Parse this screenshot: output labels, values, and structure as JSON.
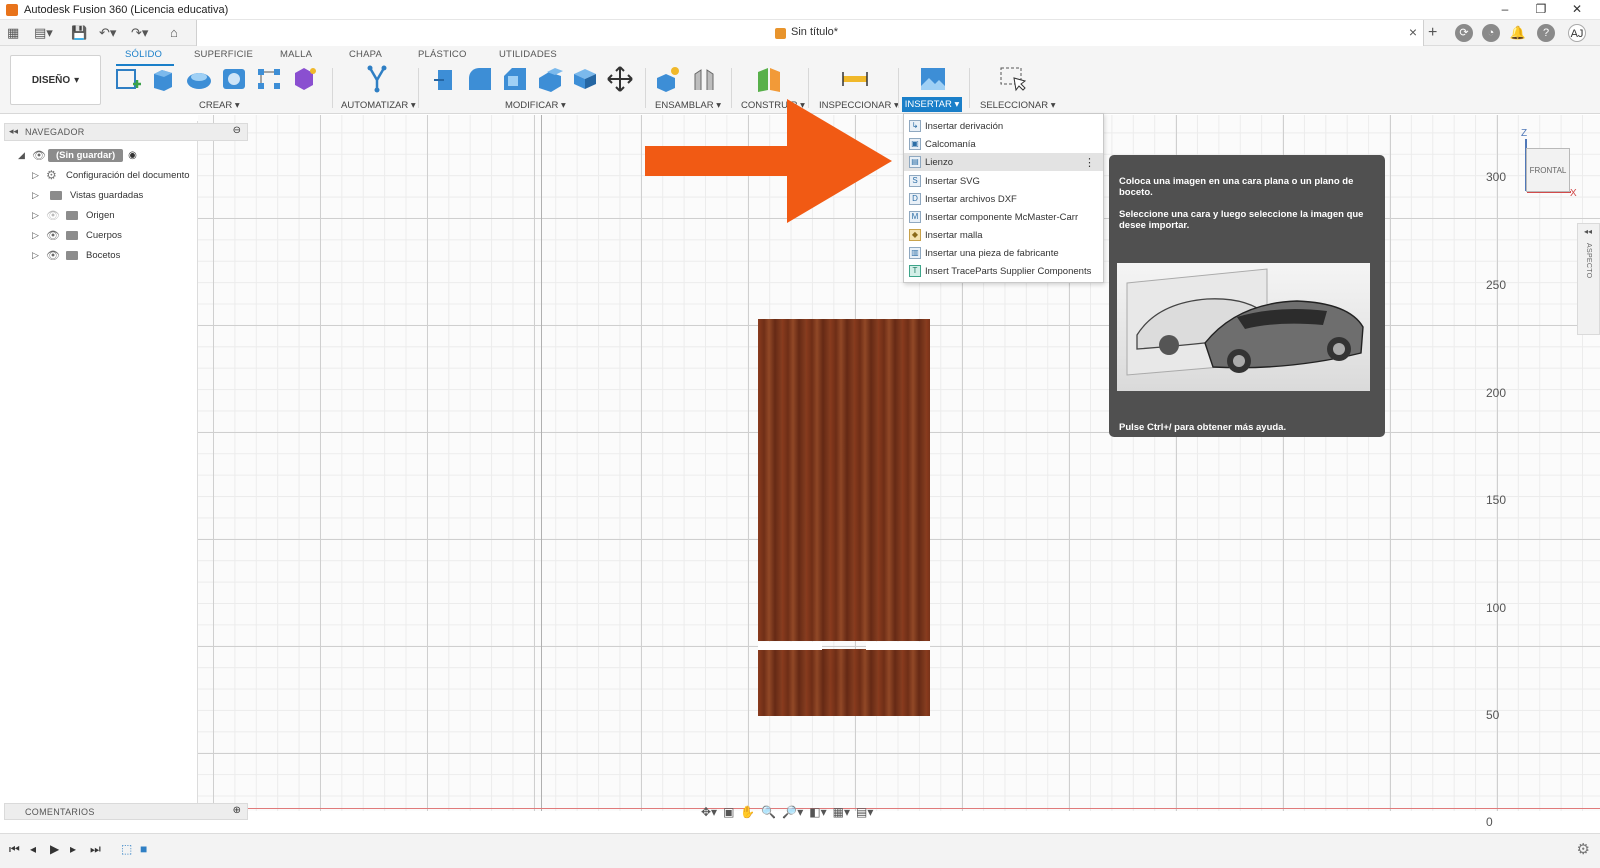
{
  "window": {
    "title": "Autodesk Fusion 360 (Licencia educativa)",
    "min_icon": "minimize-icon",
    "restore_icon": "restore-icon",
    "close_icon": "close-icon"
  },
  "quickbar": {
    "doc_title": "Sin título*",
    "user_initials": "AJ"
  },
  "toolbar": {
    "workspace": "DISEÑO",
    "tabs": [
      "SÓLIDO",
      "SUPERFICIE",
      "MALLA",
      "CHAPA",
      "PLÁSTICO",
      "UTILIDADES"
    ],
    "groups": {
      "crear": "CREAR",
      "automatizar": "AUTOMATIZAR",
      "modificar": "MODIFICAR",
      "ensamblar": "ENSAMBLAR",
      "construir": "CONSTRUIR",
      "inspeccionar": "INSPECCIONAR",
      "insertar": "INSERTAR",
      "seleccionar": "SELECCIONAR"
    }
  },
  "navigator": {
    "title": "NAVEGADOR",
    "root": "(Sin guardar)",
    "items": [
      {
        "label": "Configuración del documento"
      },
      {
        "label": "Vistas guardadas"
      },
      {
        "label": "Origen"
      },
      {
        "label": "Cuerpos"
      },
      {
        "label": "Bocetos"
      }
    ]
  },
  "insert_menu": {
    "items": [
      {
        "label": "Insertar derivación",
        "icon": "derive-icon"
      },
      {
        "label": "Calcomanía",
        "icon": "decal-icon"
      },
      {
        "label": "Lienzo",
        "icon": "canvas-icon"
      },
      {
        "label": "Insertar SVG",
        "icon": "svg-icon"
      },
      {
        "label": "Insertar archivos DXF",
        "icon": "dxf-icon"
      },
      {
        "label": "Insertar componente McMaster-Carr",
        "icon": "mcmaster-icon"
      },
      {
        "label": "Insertar malla",
        "icon": "mesh-icon"
      },
      {
        "label": "Insertar una pieza de fabricante",
        "icon": "manufacturer-part-icon"
      },
      {
        "label": "Insert TraceParts Supplier Components",
        "icon": "traceparts-icon"
      }
    ],
    "highlighted": "Lienzo"
  },
  "tooltip": {
    "text1": "Coloca una imagen en una cara plana o un plano de boceto.",
    "text2": "Seleccione una cara y luego seleccione la imagen que desee importar.",
    "help": "Pulse Ctrl+/ para obtener más ayuda."
  },
  "viewcube": {
    "face": "FRONTAL",
    "x_axis": "X",
    "z_axis": "Z",
    "aspect": "ASPECTO"
  },
  "ruler": [
    "300",
    "250",
    "200",
    "150",
    "100",
    "50",
    "0"
  ],
  "comments": {
    "title": "COMENTARIOS"
  },
  "colors": {
    "accent": "#1a7fc9",
    "arrow": "#f15a14",
    "tooltip_bg": "#505050",
    "wood": "#7a3a1f"
  }
}
